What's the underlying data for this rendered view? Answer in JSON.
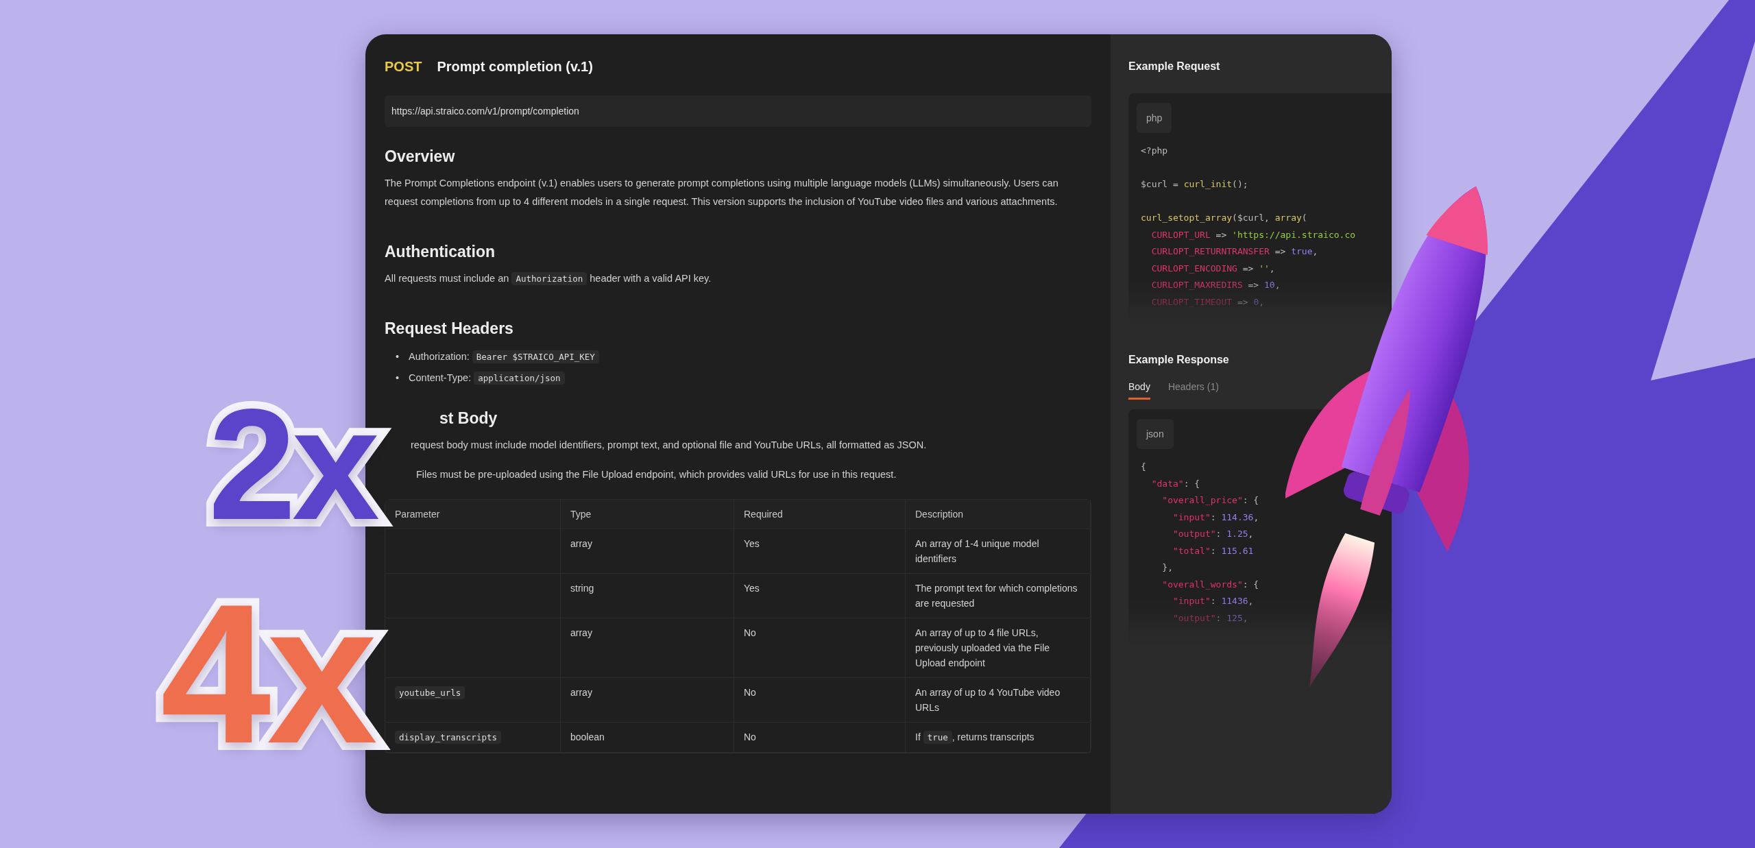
{
  "badges": [
    {
      "text": "2x",
      "color": "#5b44c9"
    },
    {
      "text": "4x",
      "color": "#ef6e4e"
    }
  ],
  "docs": {
    "method": "POST",
    "title": "Prompt completion (v.1)",
    "url": "https://api.straico.com/v1/prompt/completion",
    "sections": [
      {
        "heading": "Overview",
        "blocks": [
          {
            "kind": "paragraph",
            "parts": [
              {
                "text": "The Prompt Completions endpoint (v.1) enables users to generate prompt completions using multiple language models (LLMs) simultaneously. Users can request completions from up to 4 different models in a single request. This version supports the inclusion of YouTube video files and various attachments."
              }
            ]
          }
        ]
      },
      {
        "heading": "Authentication",
        "blocks": [
          {
            "kind": "paragraph",
            "parts": [
              {
                "text": "All requests must include an "
              },
              {
                "code": "Authorization"
              },
              {
                "text": " header with a valid API key."
              }
            ]
          }
        ]
      },
      {
        "heading": "Request Headers",
        "blocks": [
          {
            "kind": "bullets",
            "items": [
              {
                "marker": "•",
                "parts": [
                  {
                    "text": "Authorization: "
                  },
                  {
                    "code": "Bearer $STRAICO_API_KEY"
                  }
                ]
              },
              {
                "marker": "•",
                "parts": [
                  {
                    "text": "Content-Type: "
                  },
                  {
                    "code": "application/json"
                  }
                ]
              }
            ]
          }
        ]
      },
      {
        "heading": "st Body",
        "blocks": [
          {
            "kind": "paragraph",
            "parts": [
              {
                "text": "request body must include model identifiers, prompt text, and optional file and YouTube URLs, all formatted as JSON."
              }
            ]
          },
          {
            "kind": "paragraph",
            "parts": [
              {
                "text": "Files must be pre-uploaded using the File Upload endpoint, which provides valid URLs for use in this request."
              }
            ]
          }
        ]
      }
    ],
    "table": {
      "columns": [
        "Parameter",
        "Type",
        "Required",
        "Description"
      ],
      "rows": [
        {
          "parameter": "",
          "type": "array",
          "required": "Yes",
          "description": [
            {
              "text": "An array of 1-4 unique model identifiers"
            }
          ]
        },
        {
          "parameter": "",
          "type": "string",
          "required": "Yes",
          "description": [
            {
              "text": "The prompt text for which completions are requested"
            }
          ]
        },
        {
          "parameter": "",
          "type": "array",
          "required": "No",
          "description": [
            {
              "text": "An array of up to 4 file URLs, previously uploaded via the File Upload endpoint"
            }
          ]
        },
        {
          "parameter": "youtube_urls",
          "type": "array",
          "required": "No",
          "description": [
            {
              "text": "An array of up to 4 YouTube video URLs"
            }
          ]
        },
        {
          "parameter": "display_transcripts",
          "type": "boolean",
          "required": "No",
          "description": [
            {
              "text": "If "
            },
            {
              "code": "true"
            },
            {
              "text": ", returns transcripts"
            }
          ]
        }
      ]
    }
  },
  "example_request": {
    "title": "Example Request",
    "language": "php",
    "lines": [
      [
        {
          "kind": "plain",
          "text": "<?php"
        }
      ],
      [
        {
          "kind": "blank"
        }
      ],
      [
        {
          "kind": "plain",
          "text": "$curl = "
        },
        {
          "kind": "func",
          "text": "curl_init"
        },
        {
          "kind": "plain",
          "text": "();"
        }
      ],
      [
        {
          "kind": "blank"
        }
      ],
      [
        {
          "kind": "func",
          "text": "curl_setopt_array"
        },
        {
          "kind": "plain",
          "text": "($curl, "
        },
        {
          "kind": "func",
          "text": "array"
        },
        {
          "kind": "plain",
          "text": "("
        }
      ],
      [
        {
          "kind": "key",
          "text": "  CURLOPT_URL"
        },
        {
          "kind": "plain",
          "text": " => "
        },
        {
          "kind": "string",
          "text": "'https://api.straico.co"
        }
      ],
      [
        {
          "kind": "key",
          "text": "  CURLOPT_RETURNTRANSFER"
        },
        {
          "kind": "plain",
          "text": " => "
        },
        {
          "kind": "number",
          "text": "true"
        },
        {
          "kind": "plain",
          "text": ","
        }
      ],
      [
        {
          "kind": "key",
          "text": "  CURLOPT_ENCODING"
        },
        {
          "kind": "plain",
          "text": " => "
        },
        {
          "kind": "string",
          "text": "''"
        },
        {
          "kind": "plain",
          "text": ","
        }
      ],
      [
        {
          "kind": "key",
          "text": "  CURLOPT_MAXREDIRS"
        },
        {
          "kind": "plain",
          "text": " => "
        },
        {
          "kind": "number",
          "text": "10"
        },
        {
          "kind": "plain",
          "text": ","
        }
      ],
      [
        {
          "kind": "key",
          "text": "  CURLOPT_TIMEOUT"
        },
        {
          "kind": "plain",
          "text": " => "
        },
        {
          "kind": "number",
          "text": "0"
        },
        {
          "kind": "plain",
          "text": ","
        }
      ]
    ]
  },
  "example_response": {
    "title": "Example Response",
    "tabs": [
      {
        "label": "Body",
        "selected": true
      },
      {
        "label": "Headers (1)",
        "selected": false
      }
    ],
    "language": "json",
    "lines": [
      [
        {
          "kind": "plain",
          "text": "{"
        }
      ],
      [
        {
          "kind": "key",
          "text": "  \"data\""
        },
        {
          "kind": "plain",
          "text": ": {"
        }
      ],
      [
        {
          "kind": "key",
          "text": "    \"overall_price\""
        },
        {
          "kind": "plain",
          "text": ": {"
        }
      ],
      [
        {
          "kind": "key",
          "text": "      \"input\""
        },
        {
          "kind": "plain",
          "text": ": "
        },
        {
          "kind": "number",
          "text": "114.36"
        },
        {
          "kind": "plain",
          "text": ","
        }
      ],
      [
        {
          "kind": "key",
          "text": "      \"output\""
        },
        {
          "kind": "plain",
          "text": ": "
        },
        {
          "kind": "number",
          "text": "1.25"
        },
        {
          "kind": "plain",
          "text": ","
        }
      ],
      [
        {
          "kind": "key",
          "text": "      \"total\""
        },
        {
          "kind": "plain",
          "text": ": "
        },
        {
          "kind": "number",
          "text": "115.61"
        }
      ],
      [
        {
          "kind": "plain",
          "text": "    },"
        }
      ],
      [
        {
          "kind": "key",
          "text": "    \"overall_words\""
        },
        {
          "kind": "plain",
          "text": ": {"
        }
      ],
      [
        {
          "kind": "key",
          "text": "      \"input\""
        },
        {
          "kind": "plain",
          "text": ": "
        },
        {
          "kind": "number",
          "text": "11436"
        },
        {
          "kind": "plain",
          "text": ","
        }
      ],
      [
        {
          "kind": "key",
          "text": "      \"output\""
        },
        {
          "kind": "plain",
          "text": ": "
        },
        {
          "kind": "number",
          "text": "125"
        },
        {
          "kind": "plain",
          "text": ","
        }
      ]
    ]
  }
}
